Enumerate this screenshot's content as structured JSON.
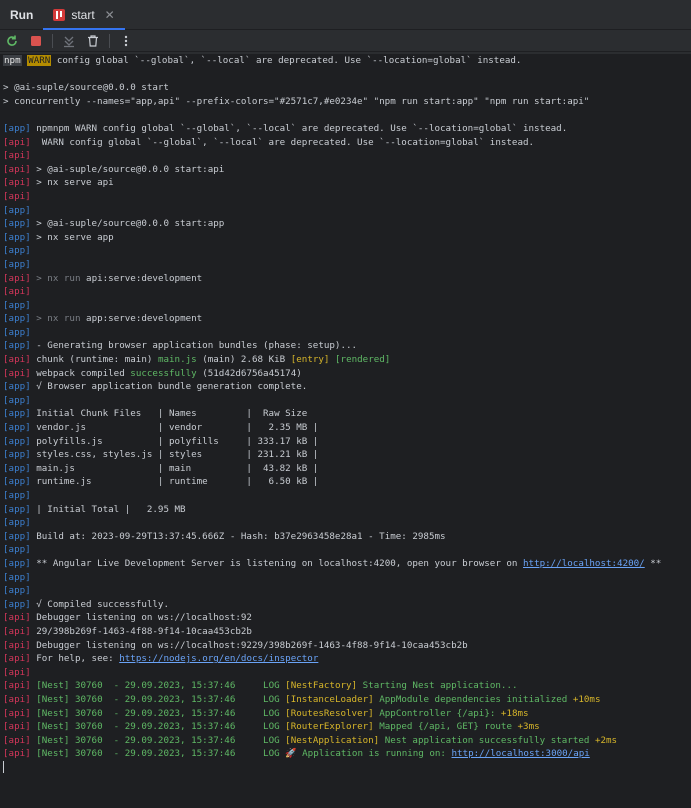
{
  "header": {
    "run_label": "Run",
    "tab_label": "start",
    "tab_close": "✕"
  },
  "toolbar": {
    "icons": [
      "rerun-icon",
      "stop-icon",
      "scroll-to-end-icon",
      "trash-icon",
      "more-icon"
    ]
  },
  "console": {
    "lines": [
      {
        "p": "",
        "s": [
          {
            "t": "npm",
            "c": "npmtag"
          },
          {
            "t": " "
          },
          {
            "t": "WARN",
            "c": "warntag"
          },
          {
            "t": " config global `--global`, `--local` are deprecated. Use `--location=global` instead."
          }
        ]
      },
      {
        "p": "",
        "s": []
      },
      {
        "p": "",
        "s": [
          {
            "t": "> @ai-suple/source@0.0.0 start"
          }
        ]
      },
      {
        "p": "",
        "s": [
          {
            "t": "> concurrently --names=\"app,api\" --prefix-colors=\"#2571c7,#e0234e\" \"npm run start:app\" \"npm run start:api\""
          }
        ]
      },
      {
        "p": "",
        "s": []
      },
      {
        "p": "app",
        "s": [
          {
            "t": " npmnpm WARN config global `--global`, `--local` are deprecated. Use `--location=global` instead."
          }
        ]
      },
      {
        "p": "api",
        "s": [
          {
            "t": "  WARN config global `--global`, `--local` are deprecated. Use `--location=global` instead."
          }
        ]
      },
      {
        "p": "api",
        "s": []
      },
      {
        "p": "api",
        "s": [
          {
            "t": " > @ai-suple/source@0.0.0 start:api"
          }
        ]
      },
      {
        "p": "api",
        "s": [
          {
            "t": " > nx serve api"
          }
        ]
      },
      {
        "p": "api",
        "s": []
      },
      {
        "p": "app",
        "s": []
      },
      {
        "p": "app",
        "s": [
          {
            "t": " > @ai-suple/source@0.0.0 start:app"
          }
        ]
      },
      {
        "p": "app",
        "s": [
          {
            "t": " > nx serve app"
          }
        ]
      },
      {
        "p": "app",
        "s": []
      },
      {
        "p": "app",
        "s": []
      },
      {
        "p": "api",
        "s": [
          {
            "t": " > nx run",
            "c": "dim"
          },
          {
            "t": " api:serve:development"
          }
        ]
      },
      {
        "p": "api",
        "s": []
      },
      {
        "p": "app",
        "s": []
      },
      {
        "p": "app",
        "s": [
          {
            "t": " > nx run",
            "c": "dim"
          },
          {
            "t": " app:serve:development"
          }
        ]
      },
      {
        "p": "app",
        "s": []
      },
      {
        "p": "app",
        "s": [
          {
            "t": " - Generating browser application bundles (phase: setup)..."
          }
        ]
      },
      {
        "p": "api",
        "s": [
          {
            "t": " chunk (runtime: main) "
          },
          {
            "t": "main.js",
            "c": "green"
          },
          {
            "t": " (main) 2.68 KiB "
          },
          {
            "t": "[entry]",
            "c": "yellow"
          },
          {
            "t": " "
          },
          {
            "t": "[rendered]",
            "c": "green"
          }
        ]
      },
      {
        "p": "api",
        "s": [
          {
            "t": " webpack compiled "
          },
          {
            "t": "successfully",
            "c": "green"
          },
          {
            "t": " (51d42d6756a45174)"
          }
        ]
      },
      {
        "p": "app",
        "s": [
          {
            "t": " √ Browser application bundle generation complete."
          }
        ]
      },
      {
        "p": "app",
        "s": []
      },
      {
        "p": "app",
        "s": [
          {
            "t": " Initial Chunk Files   | Names         |  Raw Size"
          }
        ]
      },
      {
        "p": "app",
        "s": [
          {
            "t": " vendor.js             | vendor        |   2.35 MB |"
          }
        ]
      },
      {
        "p": "app",
        "s": [
          {
            "t": " polyfills.js          | polyfills     | 333.17 kB |"
          }
        ]
      },
      {
        "p": "app",
        "s": [
          {
            "t": " styles.css, styles.js | styles        | 231.21 kB |"
          }
        ]
      },
      {
        "p": "app",
        "s": [
          {
            "t": " main.js               | main          |  43.82 kB |"
          }
        ]
      },
      {
        "p": "app",
        "s": [
          {
            "t": " runtime.js            | runtime       |   6.50 kB |"
          }
        ]
      },
      {
        "p": "app",
        "s": []
      },
      {
        "p": "app",
        "s": [
          {
            "t": " | Initial Total |   2.95 MB"
          }
        ]
      },
      {
        "p": "app",
        "s": []
      },
      {
        "p": "app",
        "s": [
          {
            "t": " Build at: 2023-09-29T13:37:45.666Z - Hash: b37e2963458e28a1 - Time: 2985ms"
          }
        ]
      },
      {
        "p": "app",
        "s": []
      },
      {
        "p": "app",
        "s": [
          {
            "t": " ** Angular Live Development Server is listening on localhost:4200, open your browser on "
          },
          {
            "t": "http://localhost:4200/",
            "c": "link"
          },
          {
            "t": " **"
          }
        ]
      },
      {
        "p": "app",
        "s": []
      },
      {
        "p": "app",
        "s": []
      },
      {
        "p": "app",
        "s": [
          {
            "t": " √ Compiled successfully."
          }
        ]
      },
      {
        "p": "api",
        "s": [
          {
            "t": " Debugger listening on ws://localhost:92"
          }
        ]
      },
      {
        "p": "api",
        "s": [
          {
            "t": " 29/398b269f-1463-4f88-9f14-10caa453cb2b"
          }
        ]
      },
      {
        "p": "api",
        "s": [
          {
            "t": " Debugger listening on ws://localhost:9229/398b269f-1463-4f88-9f14-10caa453cb2b"
          }
        ]
      },
      {
        "p": "api",
        "s": [
          {
            "t": " For help, see: "
          },
          {
            "t": "https://nodejs.org/en/docs/inspector",
            "c": "link"
          }
        ]
      },
      {
        "p": "api",
        "s": []
      },
      {
        "p": "api",
        "s": [
          {
            "t": " [Nest] 30760  - 29.09.2023, 15:37:46     ",
            "c": "nestgreen"
          },
          {
            "t": "LOG",
            "c": "nestgreen"
          },
          {
            "t": " [NestFactory] ",
            "c": "nesty"
          },
          {
            "t": "Starting Nest application...",
            "c": "nestgreen"
          }
        ]
      },
      {
        "p": "api",
        "s": [
          {
            "t": " [Nest] 30760  - 29.09.2023, 15:37:46     ",
            "c": "nestgreen"
          },
          {
            "t": "LOG",
            "c": "nestgreen"
          },
          {
            "t": " [InstanceLoader] ",
            "c": "nesty"
          },
          {
            "t": "AppModule dependencies initialized ",
            "c": "nestgreen"
          },
          {
            "t": "+10ms",
            "c": "nesty"
          }
        ]
      },
      {
        "p": "api",
        "s": [
          {
            "t": " [Nest] 30760  - 29.09.2023, 15:37:46     ",
            "c": "nestgreen"
          },
          {
            "t": "LOG",
            "c": "nestgreen"
          },
          {
            "t": " [RoutesResolver] ",
            "c": "nesty"
          },
          {
            "t": "AppController {/api}: ",
            "c": "nestgreen"
          },
          {
            "t": "+18ms",
            "c": "nesty"
          }
        ]
      },
      {
        "p": "api",
        "s": [
          {
            "t": " [Nest] 30760  - 29.09.2023, 15:37:46     ",
            "c": "nestgreen"
          },
          {
            "t": "LOG",
            "c": "nestgreen"
          },
          {
            "t": " [RouterExplorer] ",
            "c": "nesty"
          },
          {
            "t": "Mapped {/api, GET} route ",
            "c": "nestgreen"
          },
          {
            "t": "+3ms",
            "c": "nesty"
          }
        ]
      },
      {
        "p": "api",
        "s": [
          {
            "t": " [Nest] 30760  - 29.09.2023, 15:37:46     ",
            "c": "nestgreen"
          },
          {
            "t": "LOG",
            "c": "nestgreen"
          },
          {
            "t": " [NestApplication] ",
            "c": "nesty"
          },
          {
            "t": "Nest application successfully started ",
            "c": "nestgreen"
          },
          {
            "t": "+2ms",
            "c": "nesty"
          }
        ]
      },
      {
        "p": "api",
        "s": [
          {
            "t": " [Nest] 30760  - 29.09.2023, 15:37:46     ",
            "c": "nestgreen"
          },
          {
            "t": "LOG",
            "c": "nestgreen"
          },
          {
            "t": " 🚀 Application is running on: ",
            "c": "nestgreen"
          },
          {
            "t": "http://localhost:3000/api",
            "c": "link"
          }
        ]
      }
    ]
  }
}
